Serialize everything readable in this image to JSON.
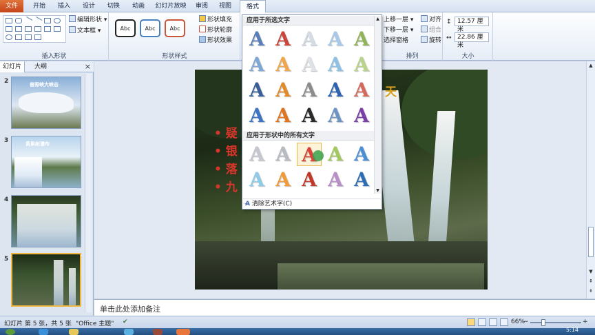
{
  "tabs": [
    "文件",
    "开始",
    "插入",
    "设计",
    "切换",
    "动画",
    "幻灯片放映",
    "审阅",
    "视图",
    "格式"
  ],
  "active_tab": "格式",
  "ribbon": {
    "insert_shapes": {
      "edit_shape": "编辑形状",
      "text_box": "文本框",
      "label": "插入形状"
    },
    "shape_styles": {
      "style_samples": [
        "Abc",
        "Abc",
        "Abc"
      ],
      "fill": "形状填充",
      "outline": "形状轮廓",
      "effects": "形状效果",
      "label": "形状样式"
    },
    "arrange": {
      "bring_forward": "上移一层",
      "send_backward": "下移一层",
      "selection_pane": "选择窗格",
      "align": "对齐",
      "group": "组合",
      "rotate": "旋转",
      "label": "排列"
    },
    "size": {
      "height": "12.57 厘米",
      "width": "22.86 厘米",
      "label": "大小"
    }
  },
  "left_panel": {
    "tabs": [
      "幻灯片",
      "大纲"
    ],
    "close": "×",
    "slides": [
      {
        "num": "2",
        "title": "普照峡大峡谷"
      },
      {
        "num": "3",
        "title": "黄果树瀑布"
      },
      {
        "num": "4",
        "title": ""
      },
      {
        "num": "5",
        "title": ""
      }
    ]
  },
  "slide": {
    "title": "天",
    "bullets": [
      "疑",
      "银",
      "落",
      "九"
    ]
  },
  "wordart_gallery": {
    "section_selected": "应用于所选文字",
    "section_all": "应用于形状中的所有文字",
    "glyph": "A",
    "clear_label": "清除艺术字(C)",
    "rows_selected": [
      [
        "#5a7fb8",
        "#c9473a",
        "#d5dce6",
        "#a8c8e8",
        "#93b35a"
      ],
      [
        "#7fa7d6",
        "#f0a64a",
        "#dfe3e8",
        "#8fc1e6",
        "#b8d48a"
      ],
      [
        "#3a5e96",
        "#e08a2a",
        "#8c8c8c",
        "#2d62b0",
        "#d46a5e"
      ],
      [
        "#3f74c4",
        "#e0731e",
        "#2a2a2a",
        "#6d94c2",
        "#7b3fa8"
      ]
    ],
    "rows_all": [
      [
        "#c4c8ce",
        "#b8bcc2",
        "#d8433a",
        "#a3c85e",
        "#4a8fd4"
      ],
      [
        "#8fcbe8",
        "#f09a38",
        "#c0392b",
        "#b88ec8",
        "#2f6eb5"
      ]
    ]
  },
  "notes_placeholder": "单击此处添加备注",
  "status": {
    "slide_info": "幻灯片 第 5 张，共 5 张",
    "theme": "\"Office 主题\"",
    "zoom": "66%",
    "time": "5:14"
  }
}
